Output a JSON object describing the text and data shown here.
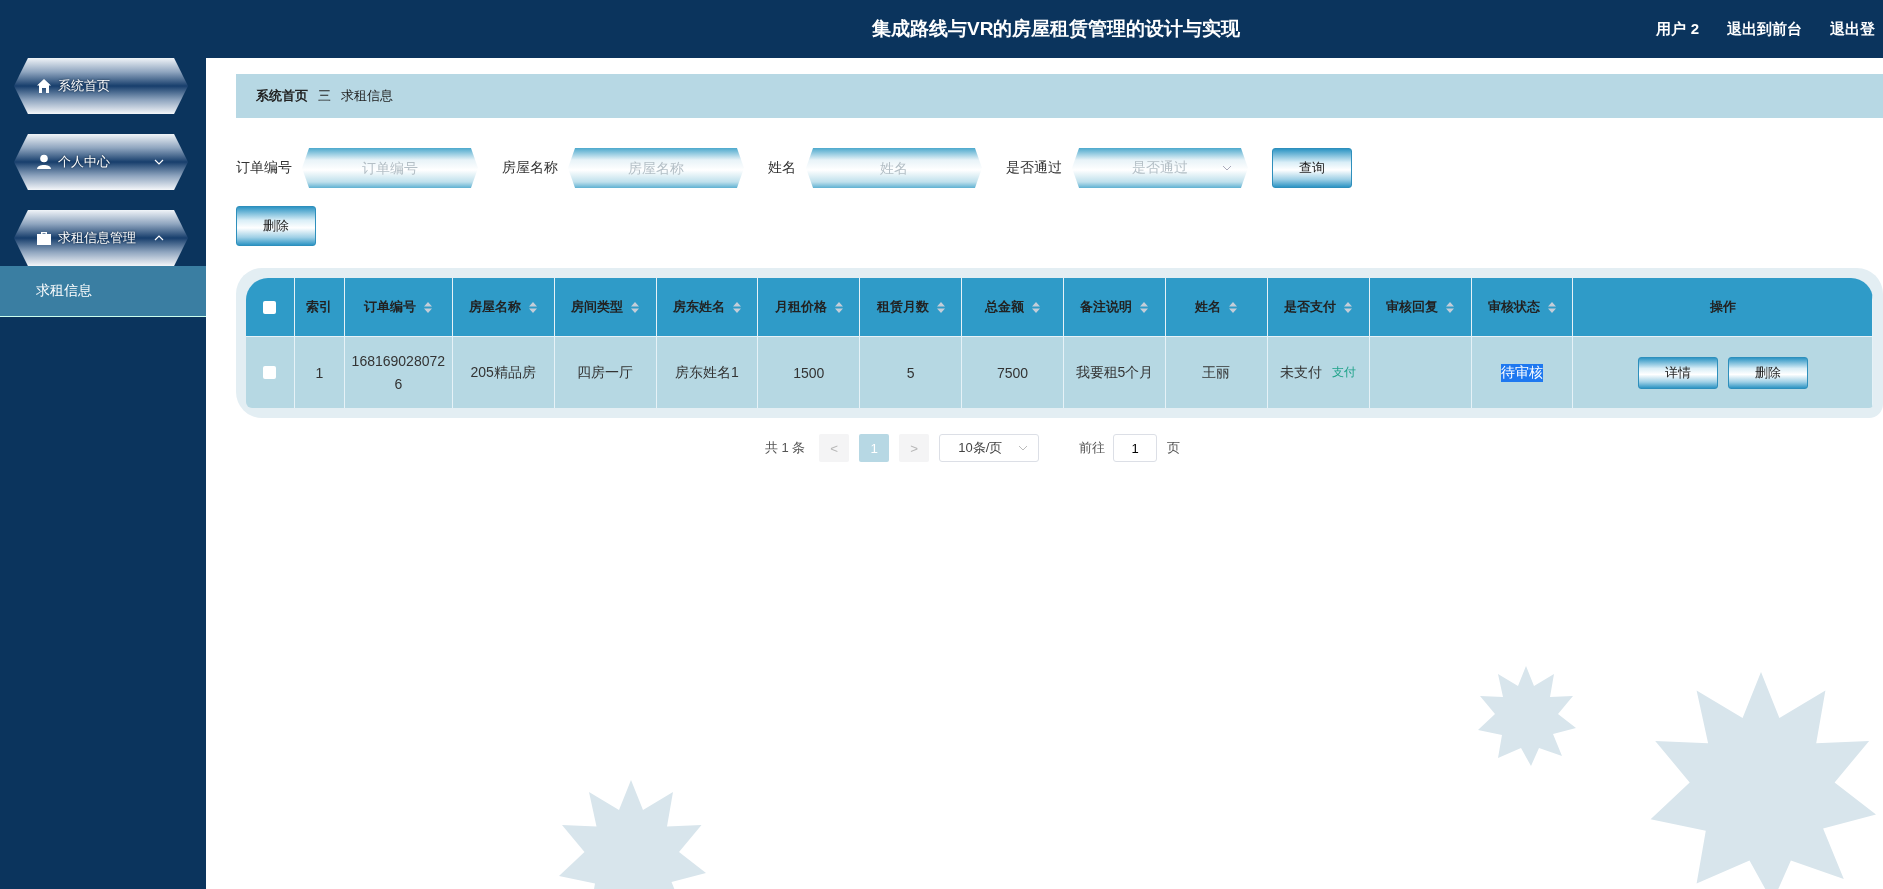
{
  "header": {
    "title": "集成路线与VR的房屋租赁管理的设计与实现",
    "links": [
      "用户 2",
      "退出到前台",
      "退出登"
    ]
  },
  "sidebar": {
    "items": [
      {
        "label": "系统首页"
      },
      {
        "label": "个人中心",
        "expanded": false
      },
      {
        "label": "求租信息管理",
        "expanded": true,
        "children": [
          {
            "label": "求租信息",
            "selected": true
          }
        ]
      }
    ]
  },
  "breadcrumb": [
    "系统首页",
    "三",
    "求租信息"
  ],
  "search": {
    "fields": [
      {
        "label": "订单编号",
        "placeholder": "订单编号",
        "kind": "input"
      },
      {
        "label": "房屋名称",
        "placeholder": "房屋名称",
        "kind": "input"
      },
      {
        "label": "姓名",
        "placeholder": "姓名",
        "kind": "input"
      },
      {
        "label": "是否通过",
        "placeholder": "是否通过",
        "kind": "select"
      }
    ],
    "button": "查询"
  },
  "delete_button": "删除",
  "table": {
    "all_checked": false,
    "columns": [
      {
        "label": "索引",
        "sortable": false
      },
      {
        "label": "订单编号",
        "sortable": true
      },
      {
        "label": "房屋名称",
        "sortable": true
      },
      {
        "label": "房间类型",
        "sortable": true
      },
      {
        "label": "房东姓名",
        "sortable": true
      },
      {
        "label": "月租价格",
        "sortable": true
      },
      {
        "label": "租赁月数",
        "sortable": true
      },
      {
        "label": "总金额",
        "sortable": true
      },
      {
        "label": "备注说明",
        "sortable": true
      },
      {
        "label": "姓名",
        "sortable": true
      },
      {
        "label": "是否支付",
        "sortable": true
      },
      {
        "label": "审核回复",
        "sortable": true
      },
      {
        "label": "审核状态",
        "sortable": true
      },
      {
        "label": "操作",
        "sortable": false
      }
    ],
    "rows": [
      {
        "checked": false,
        "cells": [
          "1",
          "1681690280726",
          "205精品房",
          "四房一厅",
          "房东姓名1",
          "1500",
          "5",
          "7500",
          "我要租5个月",
          "王丽"
        ],
        "paid": "未支付",
        "pay_link": "支付",
        "status": "待审核",
        "status_highlighted": true,
        "actions": [
          "详情",
          "删除"
        ]
      }
    ]
  },
  "pagination": {
    "total": "共 1 条",
    "prev": "<",
    "pages": [
      {
        "label": "1",
        "selected": true
      }
    ],
    "next": ">",
    "page_size": "10条/页",
    "goto_label": "前往",
    "goto_value": "1",
    "goto_suffix": "页"
  }
}
